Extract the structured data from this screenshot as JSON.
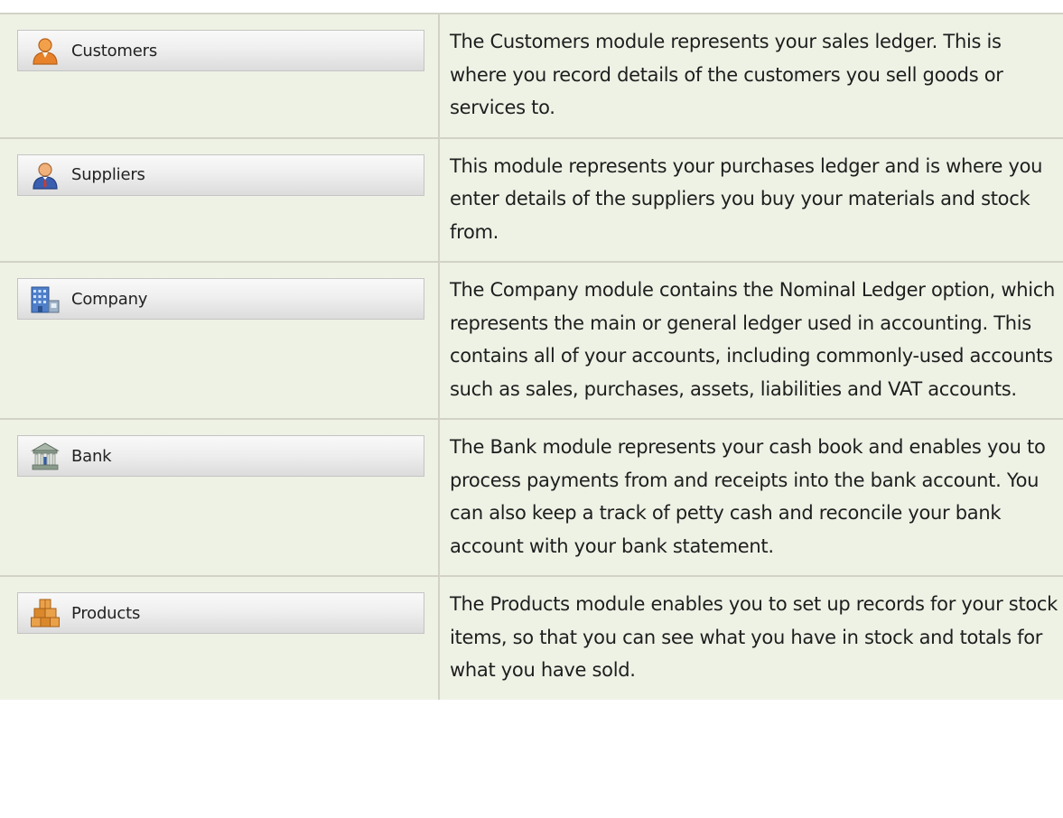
{
  "modules": [
    {
      "name": "Customers",
      "icon": "customer-person-icon",
      "description": "The Customers module represents your sales ledger. This is where you record details of the customers you sell goods or services to."
    },
    {
      "name": "Suppliers",
      "icon": "supplier-person-icon",
      "description": "This module represents your purchases ledger and is where you enter details of the suppliers you buy your materials and stock from."
    },
    {
      "name": "Company",
      "icon": "company-building-icon",
      "description": "The Company module contains the Nominal Ledger option, which represents the main or general ledger used in accounting. This contains all of your accounts, including commonly-used accounts such as sales, purchases, assets, liabilities and VAT accounts."
    },
    {
      "name": "Bank",
      "icon": "bank-building-icon",
      "description": "The Bank module represents your cash book and enables you to process payments from and receipts into the bank account. You can also keep a track of petty cash and reconcile your bank account with your bank statement."
    },
    {
      "name": "Products",
      "icon": "stacked-boxes-icon",
      "description": "The Products module enables you to set up records for your stock items, so that you can see what you have in stock and totals for what you have sold."
    }
  ],
  "colors": {
    "table_background": "#eef2e5",
    "grid_line": "#d2d2c6",
    "customer_icon": "#e8822a",
    "supplier_icon": "#3b5fb0",
    "company_icon": "#4f7fc9",
    "bank_icon": "#8a9a8c",
    "products_icon": "#d9892b"
  }
}
